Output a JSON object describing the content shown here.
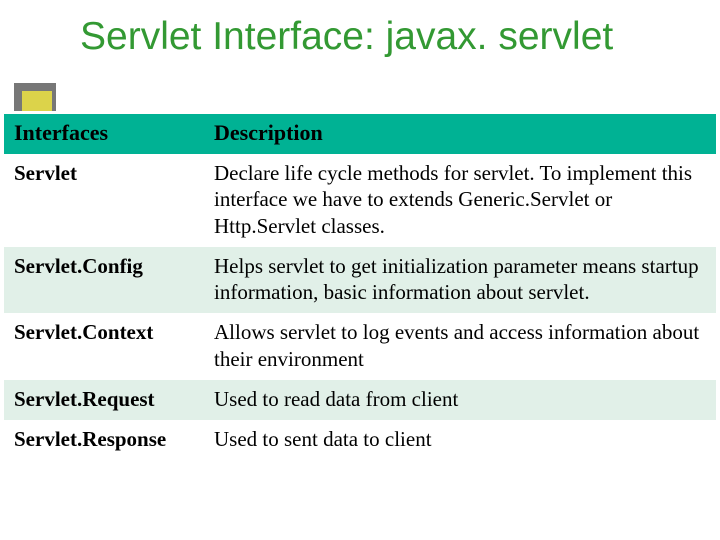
{
  "title": "Servlet Interface: javax. servlet",
  "table": {
    "headers": {
      "col1": "Interfaces",
      "col2": "Description"
    },
    "rows": [
      {
        "iface": "Servlet",
        "desc": "Declare life cycle methods for servlet. To implement this interface we have to extends Generic.Servlet or Http.Servlet classes."
      },
      {
        "iface": "Servlet.Config",
        "desc": "Helps servlet to get initialization parameter means startup information, basic information about servlet."
      },
      {
        "iface": "Servlet.Context",
        "desc": "Allows servlet to log events and access information about their environment"
      },
      {
        "iface": "Servlet.Request",
        "desc": "Used to read data from client"
      },
      {
        "iface": "Servlet.Response",
        "desc": "Used to sent data to client"
      }
    ]
  }
}
